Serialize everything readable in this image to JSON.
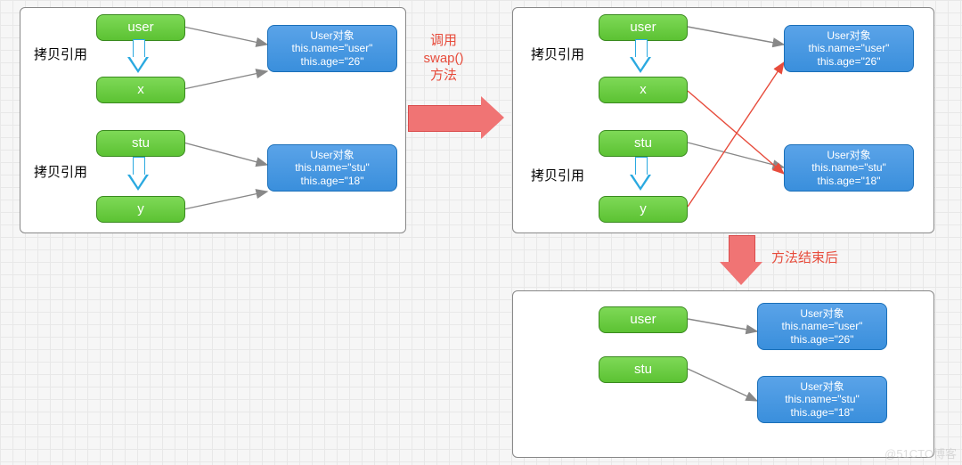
{
  "labels": {
    "copy_ref": "拷贝引用",
    "call_swap": "调用\nswap()\n方法",
    "after_method": "方法结束后"
  },
  "vars": {
    "user": "user",
    "x": "x",
    "stu": "stu",
    "y": "y"
  },
  "objects": {
    "user_obj": {
      "title": "User对象",
      "line1": "this.name=\"user\"",
      "line2": "this.age=\"26\""
    },
    "stu_obj": {
      "title": "User对象",
      "line1": "this.name=\"stu\"",
      "line2": "this.age=\"18\""
    }
  },
  "watermark": "@51CTO博客"
}
